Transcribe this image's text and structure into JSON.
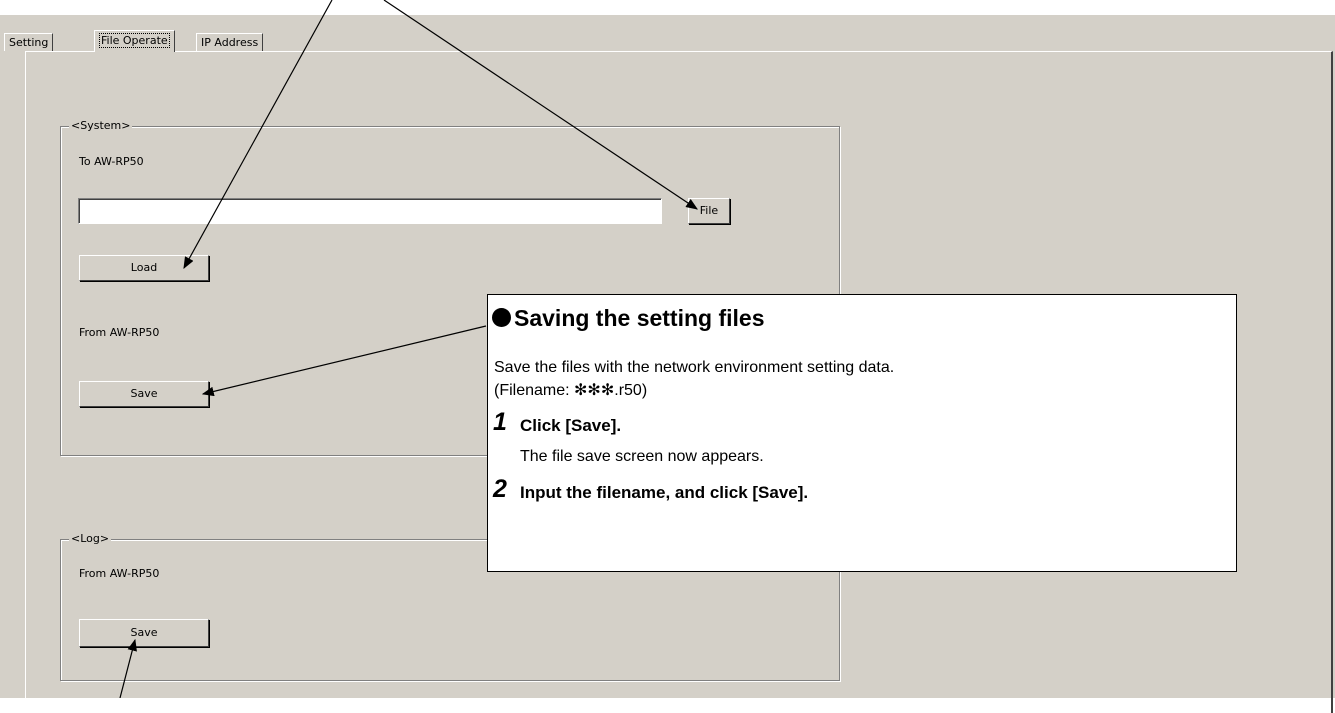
{
  "tabs": [
    "Setting",
    "File Operate",
    "IP Address"
  ],
  "system_group": {
    "legend": "<System>",
    "to_label": "To AW-RP50",
    "file_path_value": "",
    "file_button": "File",
    "load_button": "Load",
    "from_label": "From AW-RP50",
    "save_button": "Save"
  },
  "log_group": {
    "legend": "<Log>",
    "from_label": "From AW-RP50",
    "save_button": "Save"
  },
  "callout": {
    "title": "Saving the setting files",
    "description_line1": "Save the files with the network environment setting data.",
    "description_line2": "(Filename: ✻✻✻.r50)",
    "step1_number": "1",
    "step1_text": "Click [Save].",
    "step1_detail": "The file save screen now appears.",
    "step2_number": "2",
    "step2_text": "Input the filename, and click [Save]."
  }
}
